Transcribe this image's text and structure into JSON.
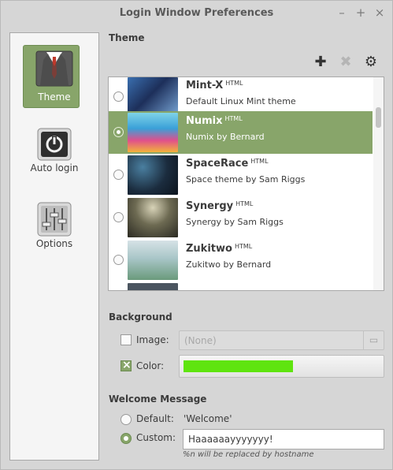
{
  "window": {
    "title": "Login Window Preferences",
    "buttons": {
      "minimize": "–",
      "maximize": "+",
      "close": "×"
    }
  },
  "sidebar": {
    "items": [
      {
        "label": "Theme",
        "icon": "suit-icon",
        "active": true
      },
      {
        "label": "Auto login",
        "icon": "power-icon",
        "active": false
      },
      {
        "label": "Options",
        "icon": "sliders-icon",
        "active": false
      }
    ]
  },
  "theme_section": {
    "title": "Theme",
    "toolbar": {
      "add": "✚",
      "remove": "✖",
      "settings": "⚙"
    },
    "themes": [
      {
        "name": "Mint-X",
        "badge": "HTML",
        "desc": "Default Linux Mint theme",
        "selected": false
      },
      {
        "name": "Numix",
        "badge": "HTML",
        "desc": "Numix by Bernard",
        "selected": true
      },
      {
        "name": "SpaceRace",
        "badge": "HTML",
        "desc": "Space theme by Sam Riggs",
        "selected": false
      },
      {
        "name": "Synergy",
        "badge": "HTML",
        "desc": "Synergy by Sam Riggs",
        "selected": false
      },
      {
        "name": "Zukitwo",
        "badge": "HTML",
        "desc": "Zukitwo by Bernard",
        "selected": false
      }
    ]
  },
  "background_section": {
    "title": "Background",
    "image_label": "Image:",
    "image_checked": false,
    "image_placeholder": "(None)",
    "color_label": "Color:",
    "color_checked": true,
    "color_value": "#5fe40f"
  },
  "welcome_section": {
    "title": "Welcome Message",
    "default_label": "Default:",
    "default_value": "'Welcome'",
    "custom_label": "Custom:",
    "custom_value": "Haaaaaayyyyyyy!",
    "selected": "custom",
    "hint": "%n will be replaced by hostname"
  },
  "colors": {
    "accent": "#88a56a"
  }
}
